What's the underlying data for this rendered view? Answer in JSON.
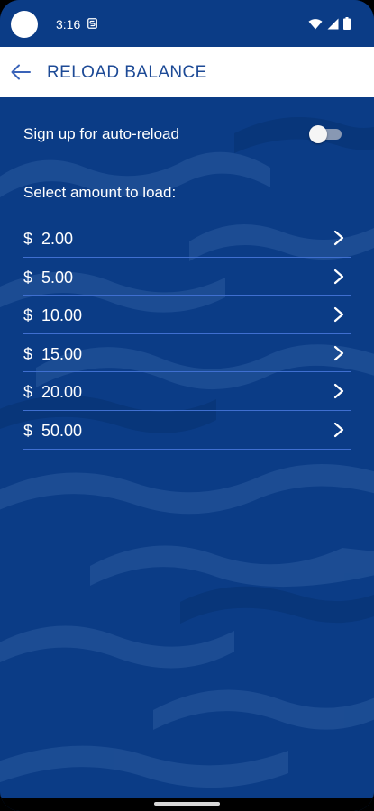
{
  "status_bar": {
    "time": "3:16",
    "icons": [
      "notification-circle-icon",
      "s-notification-icon",
      "wifi-icon",
      "cellular-signal-icon",
      "battery-icon"
    ]
  },
  "app_bar": {
    "title": "RELOAD BALANCE",
    "back_icon": "arrow-left-icon"
  },
  "content": {
    "auto_reload_label": "Sign up for auto-reload",
    "auto_reload_enabled": false,
    "select_label": "Select amount to load:",
    "amounts": [
      {
        "label": "$  2.00"
      },
      {
        "label": "$  5.00"
      },
      {
        "label": "$  10.00"
      },
      {
        "label": "$  15.00"
      },
      {
        "label": "$  20.00"
      },
      {
        "label": "$  50.00"
      }
    ]
  },
  "colors": {
    "background": "#0b3c86",
    "app_bar": "#ffffff",
    "title": "#1d4a96",
    "divider": "#3f6fd0",
    "text": "#ffffff"
  }
}
